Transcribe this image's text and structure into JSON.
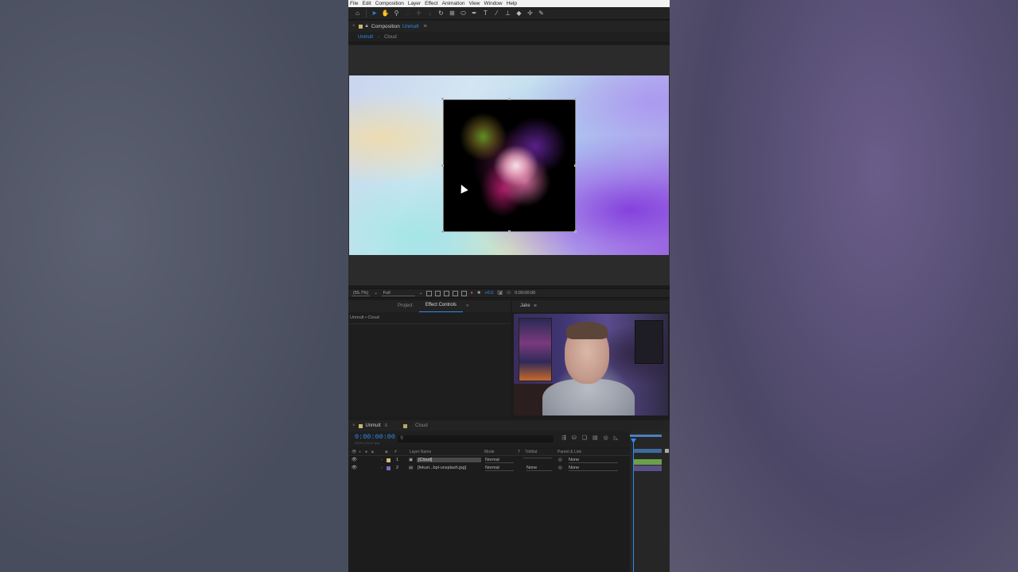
{
  "menubar": [
    "File",
    "Edit",
    "Composition",
    "Layer",
    "Effect",
    "Animation",
    "View",
    "Window",
    "Help"
  ],
  "composition_panel": {
    "label": "Composition",
    "name": "Unmult",
    "tabs": [
      "Unmult",
      "Cloud"
    ]
  },
  "viewer_bar": {
    "zoom": "(55.7%)",
    "resolution": "Full",
    "exposure": "+0.0",
    "timecode": "0:00:00:00"
  },
  "effect_panel": {
    "tabs": [
      "Project",
      "Effect Controls"
    ],
    "subtitle": "Unmult • Cloud"
  },
  "camera_panel": {
    "tab": "Jake"
  },
  "timeline": {
    "tabs": [
      "Unmult",
      "Cloud"
    ],
    "timecode": "0:00:00:00",
    "fps": "00000 (24.00 fps)",
    "search_placeholder": "",
    "columns": {
      "index": "#",
      "layer_name": "Layer Name",
      "mode": "Mode",
      "t": "T",
      "trkmat": "TrkMat",
      "parent": "Parent & Link"
    },
    "layers": [
      {
        "index": "1",
        "name": "[Cloud]",
        "mode": "Normal",
        "trkmat": "",
        "parent": "None",
        "color": "#c9c07a"
      },
      {
        "index": "2",
        "name": "[fekuri...bpl-unsplash.jpg]",
        "mode": "Normal",
        "trkmat": "None",
        "parent": "None",
        "color": "#7a6cc4"
      }
    ]
  },
  "colors": {
    "accent": "#2d8ceb",
    "panel": "#232323",
    "bg": "#1c1c1c"
  }
}
